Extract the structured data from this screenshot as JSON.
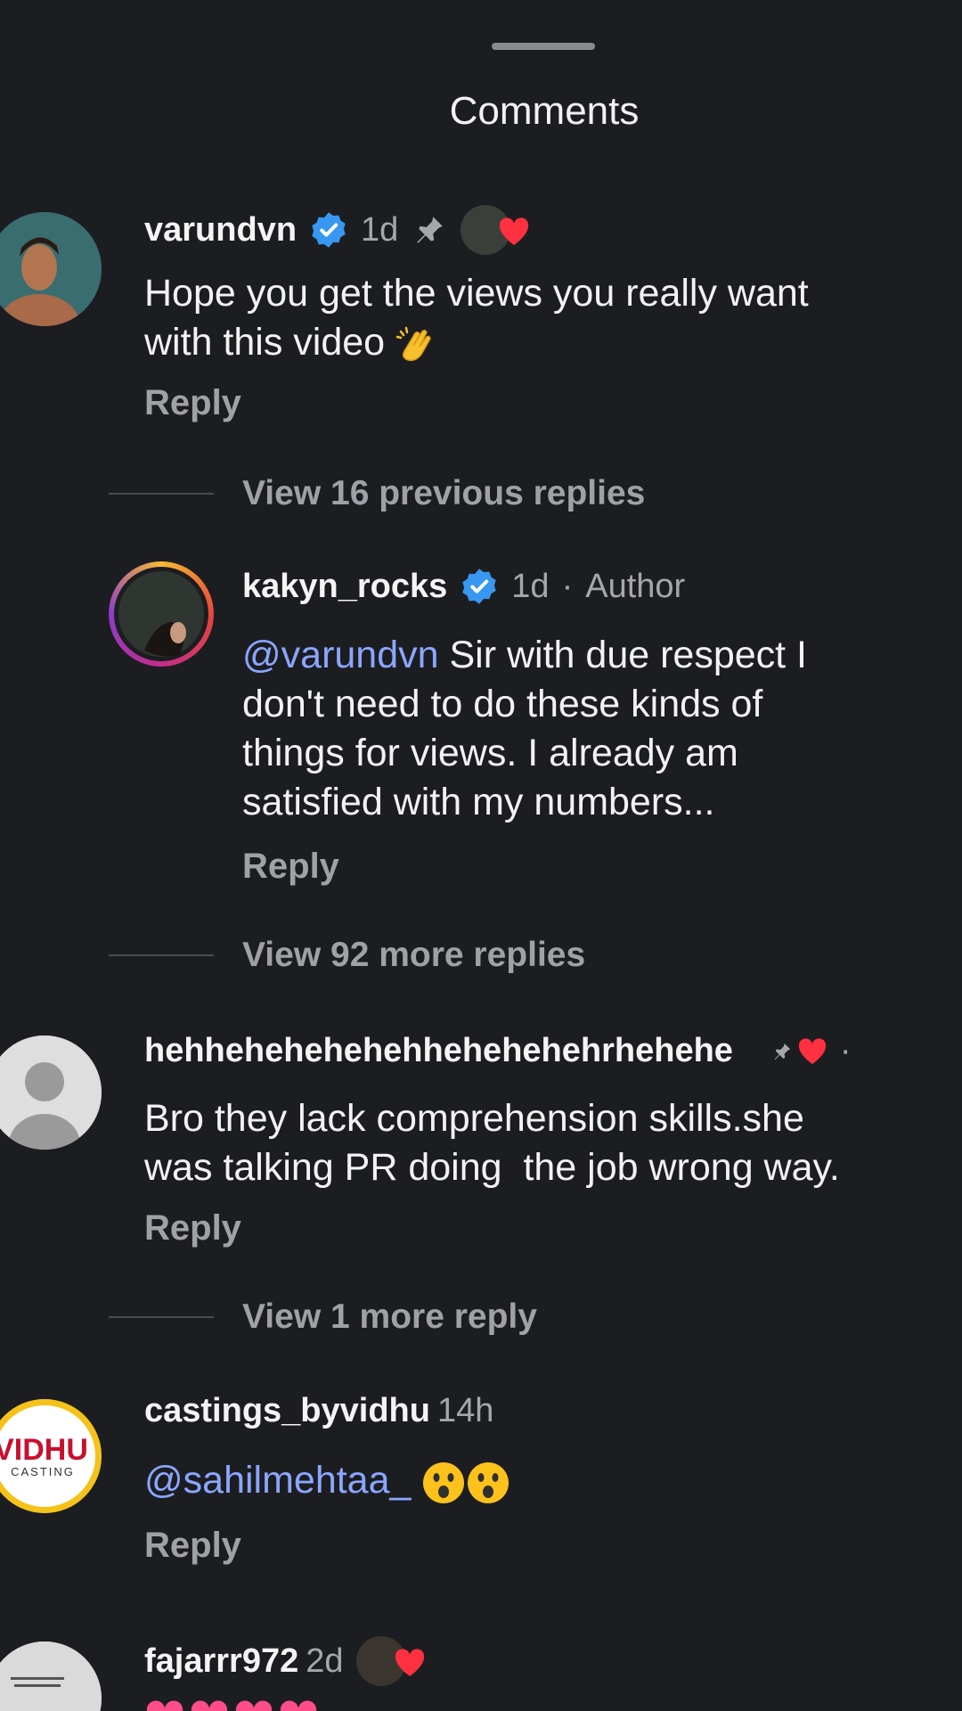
{
  "sheet": {
    "title": "Comments"
  },
  "comments": [
    {
      "username": "varundvn",
      "time": "1d",
      "text": "Hope you get the views you really want\nwith this video",
      "reply_label": "Reply"
    },
    {
      "username": "kakyn_rocks",
      "time": "1d",
      "separator": "·",
      "author_label": "Author",
      "mention": "@varundvn",
      "text": " Sir with due respect I\ndon't need to do these kinds of\nthings for views. I already am\nsatisfied with my numbers...",
      "reply_label": "Reply"
    },
    {
      "username": "hehhehehehehehhehehehehrhehehe",
      "separator": "·",
      "text": "Bro they lack comprehension skills.she\nwas talking PR doing  the job wrong way.",
      "reply_label": "Reply"
    },
    {
      "username": "castings_byvidhu",
      "time": "14h",
      "mention": "@sahilmehtaa_",
      "reply_label": "Reply",
      "avatar_logo_top": "VIDHU",
      "avatar_logo_bottom": "CASTING"
    },
    {
      "username": "fajarrr972",
      "time": "2d"
    }
  ],
  "view_replies": [
    "View 16 previous replies",
    "View 92 more replies",
    "View 1 more reply"
  ],
  "colors": {
    "background": "#1c1d21",
    "mention": "#8aa6ff",
    "verified": "#3897f0",
    "heart": "#ff3040"
  },
  "icons": [
    "verified-badge-icon",
    "pin-icon",
    "heart-icon",
    "clapping-hands-emoji",
    "astonished-face-emoji"
  ]
}
